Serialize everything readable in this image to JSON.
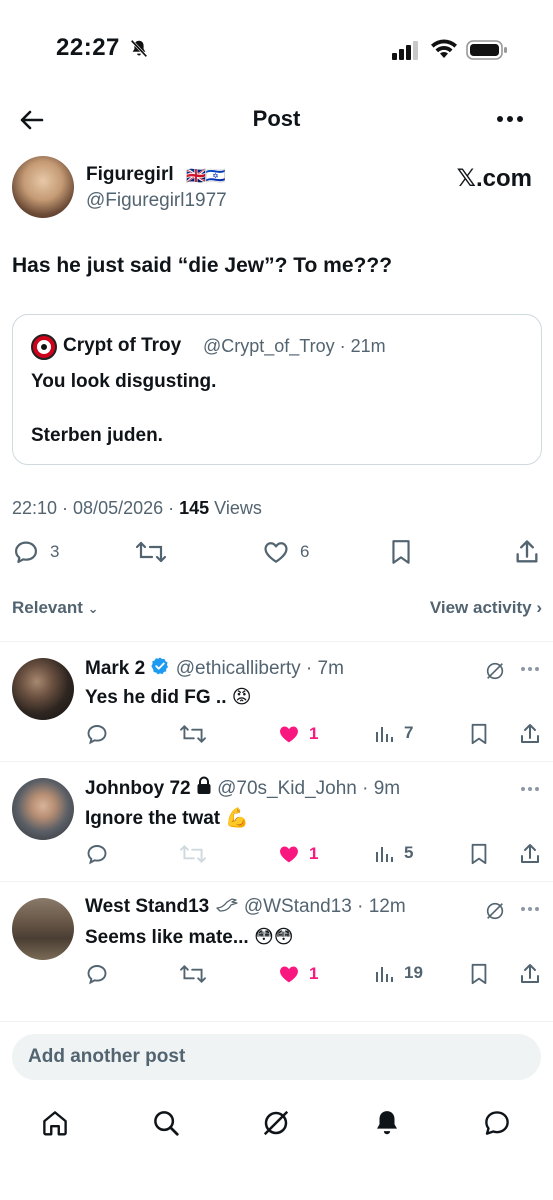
{
  "status_bar": {
    "time": "22:27"
  },
  "nav": {
    "title": "Post"
  },
  "post": {
    "author_name": "Figuregirl",
    "author_flags": "🇬🇧🇮🇱",
    "author_handle": "@Figuregirl1977",
    "source": "𝕏.com",
    "text": "Has he just said “die Jew”? To me???",
    "quote": {
      "name": "Crypt of Troy",
      "handle_time": "@Crypt_of_Troy · 21m",
      "line1": "You look disgusting.",
      "line2": "Sterben juden."
    },
    "timestamp": "22:10 · 08/05/2026 · ",
    "views_count": "145",
    "views_label": " Views",
    "replies": "3",
    "likes": "6"
  },
  "filter": {
    "relevant": "Relevant",
    "view_activity": "View activity"
  },
  "replies": [
    {
      "name": "Mark 2",
      "badge": "verified",
      "handle_time": "@ethicalliberty · 7m",
      "text": "Yes he did FG .. 😡",
      "likes": "1",
      "views": "7"
    },
    {
      "name": "Johnboy 72",
      "badge": "lock",
      "handle_time": "@70s_Kid_John · 9m",
      "text": "Ignore the twat 💪",
      "likes": "1",
      "views": "5"
    },
    {
      "name": "West Stand13",
      "badge": "bird",
      "handle_time": "@WStand13 · 12m",
      "text": "Seems like mate... 😳😳",
      "likes": "1",
      "views": "19"
    }
  ],
  "compose": {
    "placeholder": "Add another post"
  },
  "colors": {
    "like": "#f91880",
    "verified": "#1d9bf0",
    "muted": "#536471"
  }
}
